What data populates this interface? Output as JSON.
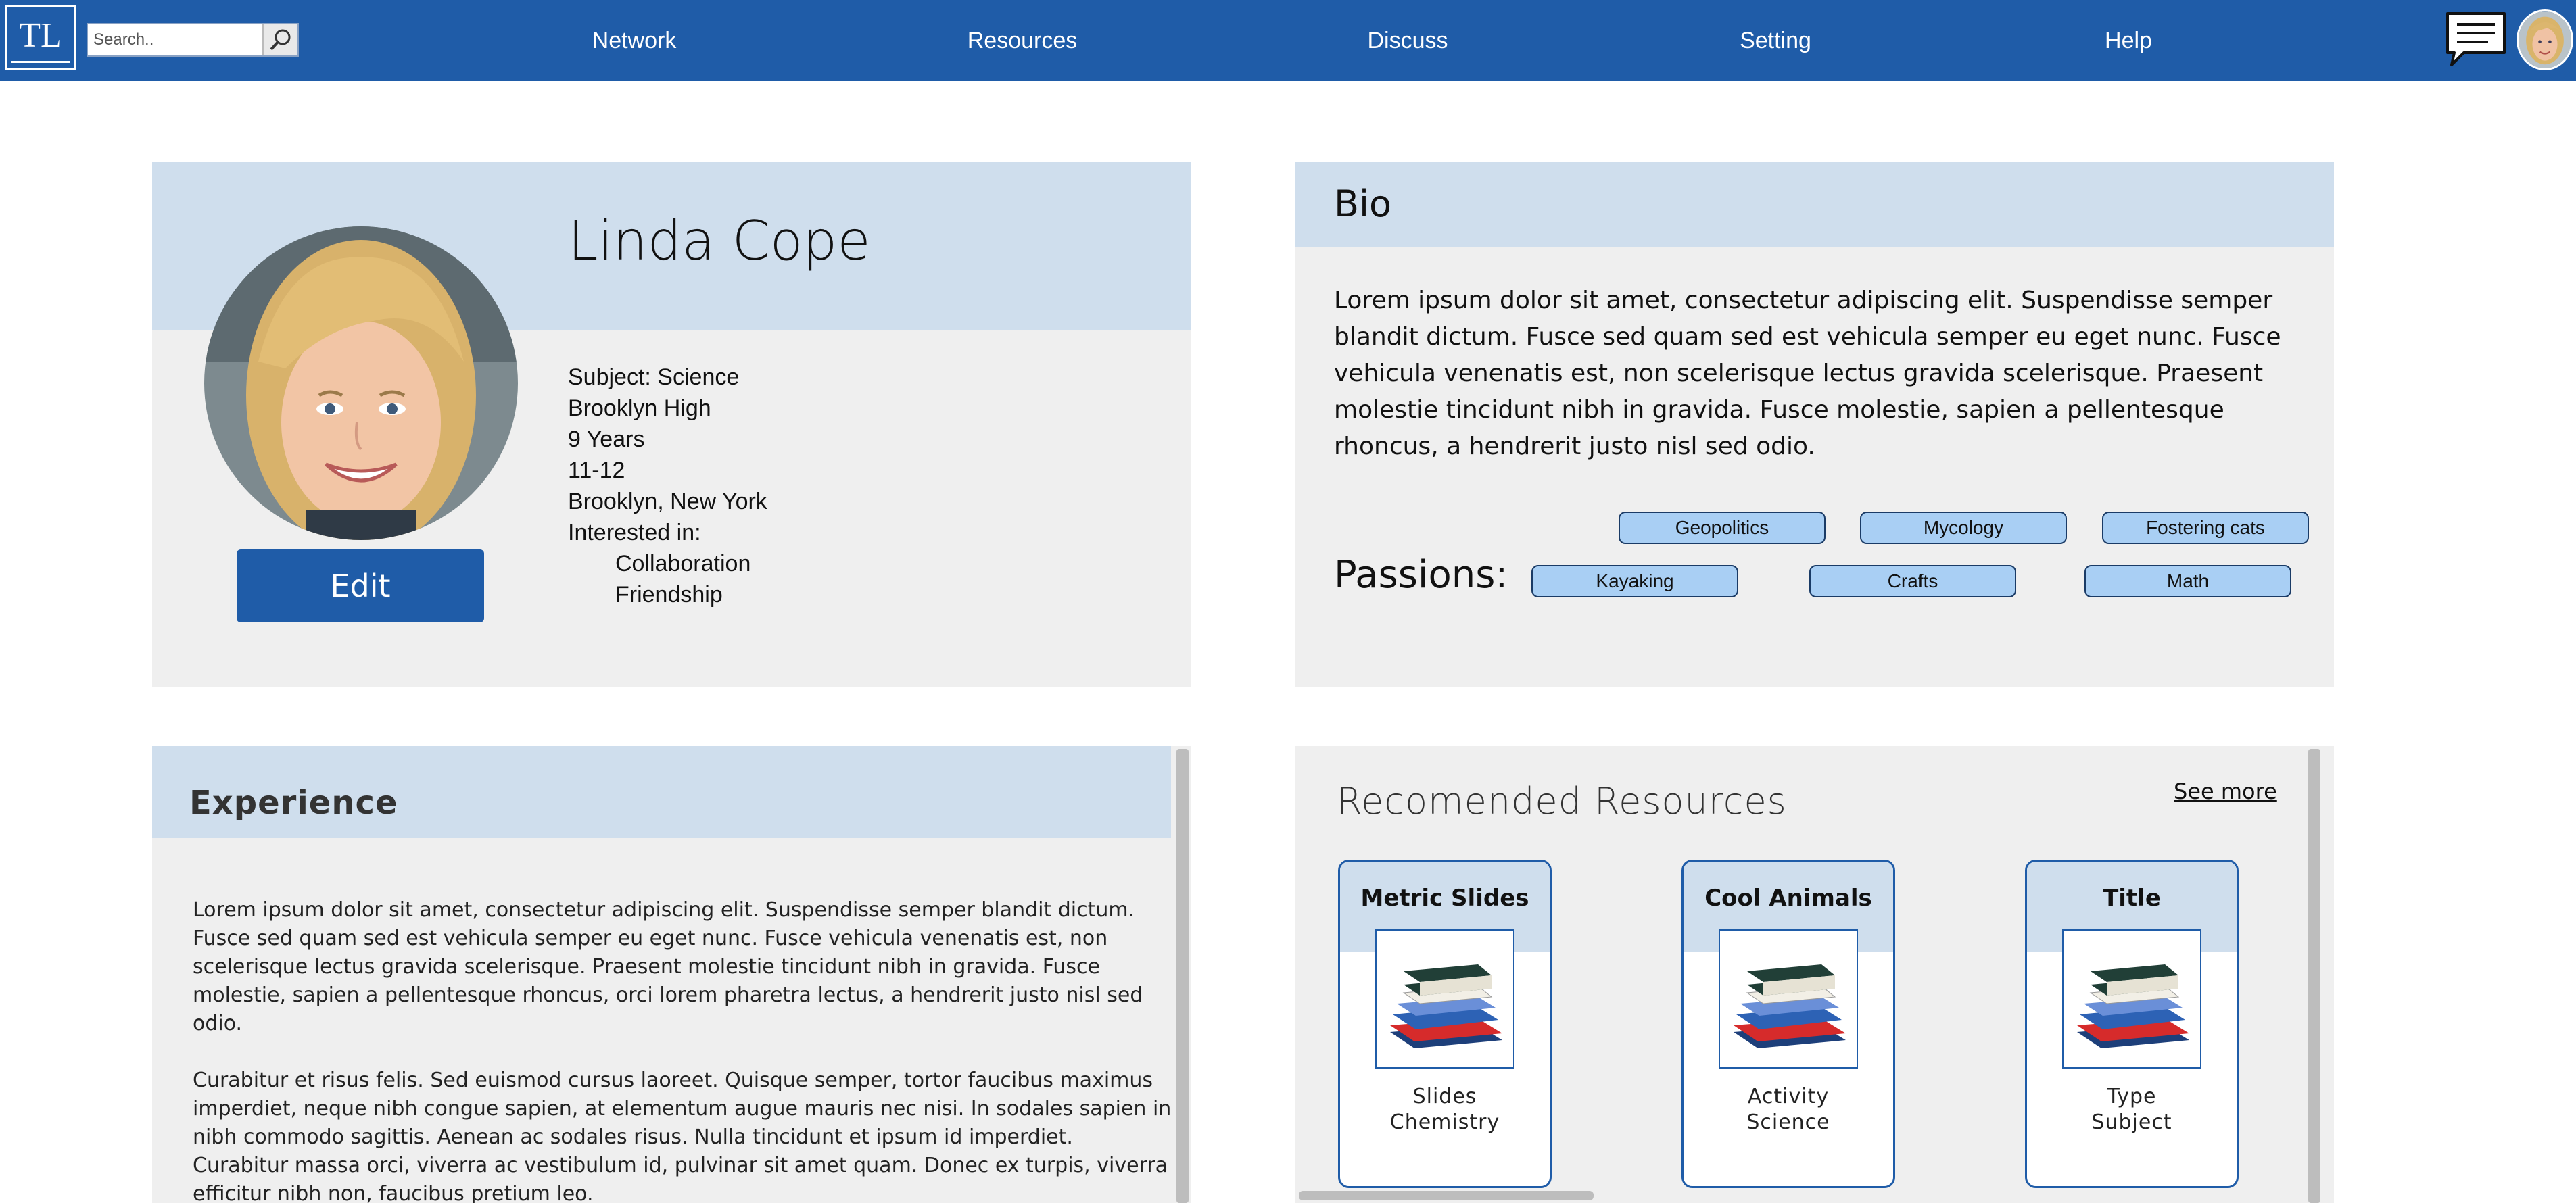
{
  "header": {
    "logo_text": "TL",
    "search": {
      "placeholder": "Search..",
      "value": ""
    },
    "nav": [
      {
        "label": "Network"
      },
      {
        "label": "Resources"
      },
      {
        "label": "Discuss"
      },
      {
        "label": "Setting"
      },
      {
        "label": "Help"
      }
    ],
    "icons": {
      "search": "magnifier-icon",
      "chat": "chat-bubble-icon",
      "avatar": "user-avatar"
    }
  },
  "profile": {
    "name": "Linda Cope",
    "details": [
      "Subject: Science",
      "Brooklyn High",
      "9 Years",
      "11-12",
      "Brooklyn, New York",
      "Interested in:"
    ],
    "interests": [
      "Collaboration",
      "Friendship"
    ],
    "edit_label": "Edit"
  },
  "bio": {
    "title": "Bio",
    "text": "Lorem ipsum dolor sit amet, consectetur adipiscing elit. Suspendisse semper blandit dictum. Fusce sed quam sed est vehicula semper eu eget nunc. Fusce vehicula venenatis est, non scelerisque lectus gravida scelerisque. Praesent molestie tincidunt nibh in gravida. Fusce molestie, sapien a pellentesque rhoncus, a hendrerit justo nisl sed odio.",
    "passions_label": "Passions:",
    "passions": [
      "Geopolitics",
      "Mycology",
      "Fostering cats",
      "Kayaking",
      "Crafts",
      "Math"
    ]
  },
  "experience": {
    "title": "Experience",
    "paragraphs": [
      "Lorem ipsum dolor sit amet, consectetur adipiscing elit. Suspendisse semper blandit dictum. Fusce sed quam sed est vehicula semper eu eget nunc. Fusce vehicula venenatis est, non scelerisque lectus gravida scelerisque. Praesent molestie tincidunt nibh in gravida. Fusce molestie, sapien a pellentesque rhoncus, orci lorem pharetra lectus, a hendrerit justo nisl sed odio.",
      "Curabitur et risus felis. Sed euismod cursus laoreet. Quisque semper, tortor faucibus maximus imperdiet, neque nibh congue sapien, at elementum augue mauris nec nisi. In sodales sapien in nibh commodo sagittis. Aenean ac sodales risus. Nulla tincidunt et ipsum id imperdiet. Curabitur massa orci, viverra ac vestibulum id, pulvinar sit amet quam. Donec ex turpis, viverra efficitur nibh non, faucibus pretium leo."
    ]
  },
  "resources": {
    "title": "Recomended Resources",
    "see_more": "See more",
    "items": [
      {
        "title": "Metric Slides",
        "line1": "Slides",
        "line2": "Chemistry",
        "icon": "books-icon"
      },
      {
        "title": "Cool Animals",
        "line1": "Activity",
        "line2": "Science",
        "icon": "books-icon"
      },
      {
        "title": "Title",
        "line1": "Type",
        "line2": "Subject",
        "icon": "books-icon"
      }
    ]
  },
  "colors": {
    "primary": "#1f5ca8",
    "band": "#cfdeed",
    "card_bg": "#efefef",
    "pill": "#a9cff4"
  }
}
